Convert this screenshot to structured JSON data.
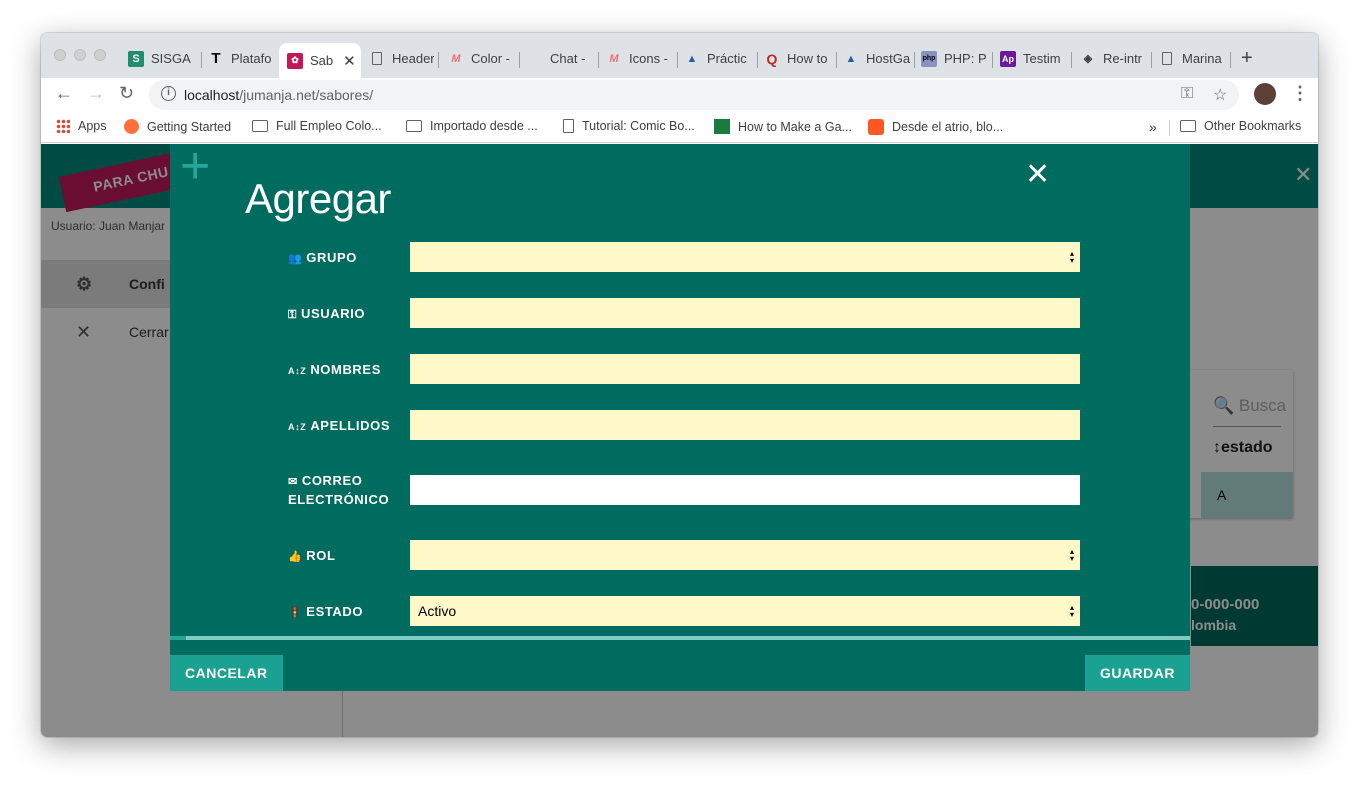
{
  "browser": {
    "tabs": [
      {
        "label": "SISGA",
        "icon": "sisga-favicon",
        "color": "#1e8e6e"
      },
      {
        "label": "Platafo",
        "icon": "t-favicon",
        "color": "#000000"
      },
      {
        "label": "Sab",
        "icon": "sabores-favicon",
        "color": "#c2185b",
        "active": true
      },
      {
        "label": "Header",
        "icon": "document-icon"
      },
      {
        "label": "Color -",
        "icon": "materialize-favicon",
        "color": "#ee6e73"
      },
      {
        "label": "Chat -",
        "icon": ""
      },
      {
        "label": "Icons -",
        "icon": "materialize-favicon",
        "color": "#ee6e73"
      },
      {
        "label": "Práctic",
        "icon": "hostgator-favicon"
      },
      {
        "label": "How to",
        "icon": "quora-favicon",
        "color": "#b92b27"
      },
      {
        "label": "HostGa",
        "icon": "hostgator-favicon"
      },
      {
        "label": "PHP: P",
        "icon": "php-favicon"
      },
      {
        "label": "Testim",
        "icon": "ap-favicon",
        "color": "#6a1b9a"
      },
      {
        "label": "Re-intr",
        "icon": "code-favicon"
      },
      {
        "label": "Marina",
        "icon": "document-icon"
      }
    ],
    "url_host": "localhost",
    "url_path": "/jumanja.net/sabores/",
    "bookmarks": [
      {
        "label": "Apps",
        "icon": "apps-grid-icon"
      },
      {
        "label": "Getting Started",
        "icon": "firefox-icon"
      },
      {
        "label": "Full Empleo Colo...",
        "icon": "folder-icon"
      },
      {
        "label": "Importado desde ...",
        "icon": "folder-icon"
      },
      {
        "label": "Tutorial: Comic Bo...",
        "icon": "document-icon"
      },
      {
        "label": "How to Make a Ga...",
        "icon": "m-favicon"
      },
      {
        "label": "Desde el atrio, blo...",
        "icon": "blogger-icon"
      }
    ],
    "bookmarks_more": "»",
    "other_bookmarks": "Other Bookmarks"
  },
  "page": {
    "ribbon_text": "PARA CHU",
    "user_line": "Usuario: Juan Manjar",
    "sidebar": [
      {
        "label": "Confi",
        "icon": "gear-icon"
      },
      {
        "label": "Cerrar",
        "icon": "close-icon"
      }
    ],
    "search_placeholder": "Busca",
    "table_header": "↕estado",
    "table_cell": "A",
    "footer_line1": "0-000-000",
    "footer_line2": "lombia"
  },
  "modal": {
    "title": "Agregar",
    "fields": [
      {
        "label": "GRUPO",
        "icon": "group-icon",
        "value": "",
        "type": "select"
      },
      {
        "label": "USUARIO",
        "icon": "key-icon",
        "value": "",
        "type": "text"
      },
      {
        "label": "NOMBRES",
        "icon": "sort-az-icon",
        "value": "",
        "type": "text"
      },
      {
        "label": "APELLIDOS",
        "icon": "sort-az-icon",
        "value": "",
        "type": "text"
      },
      {
        "label_line1": "CORREO",
        "label_line2": "ELECTRÓNICO",
        "icon": "mail-icon",
        "value": "",
        "type": "text"
      },
      {
        "label": "ROL",
        "icon": "thumb-up-icon",
        "value": "",
        "type": "select"
      },
      {
        "label": "ESTADO",
        "icon": "traffic-light-icon",
        "value": "Activo",
        "type": "select"
      }
    ],
    "progress": 0.016,
    "cancel_label": "CANCELAR",
    "save_label": "GUARDAR"
  },
  "colors": {
    "modal_bg": "#006b5f",
    "header_bg": "#00897b",
    "field_bg": "#fff8c9",
    "button_bg": "#1aa191",
    "accent": "#26a69a"
  }
}
